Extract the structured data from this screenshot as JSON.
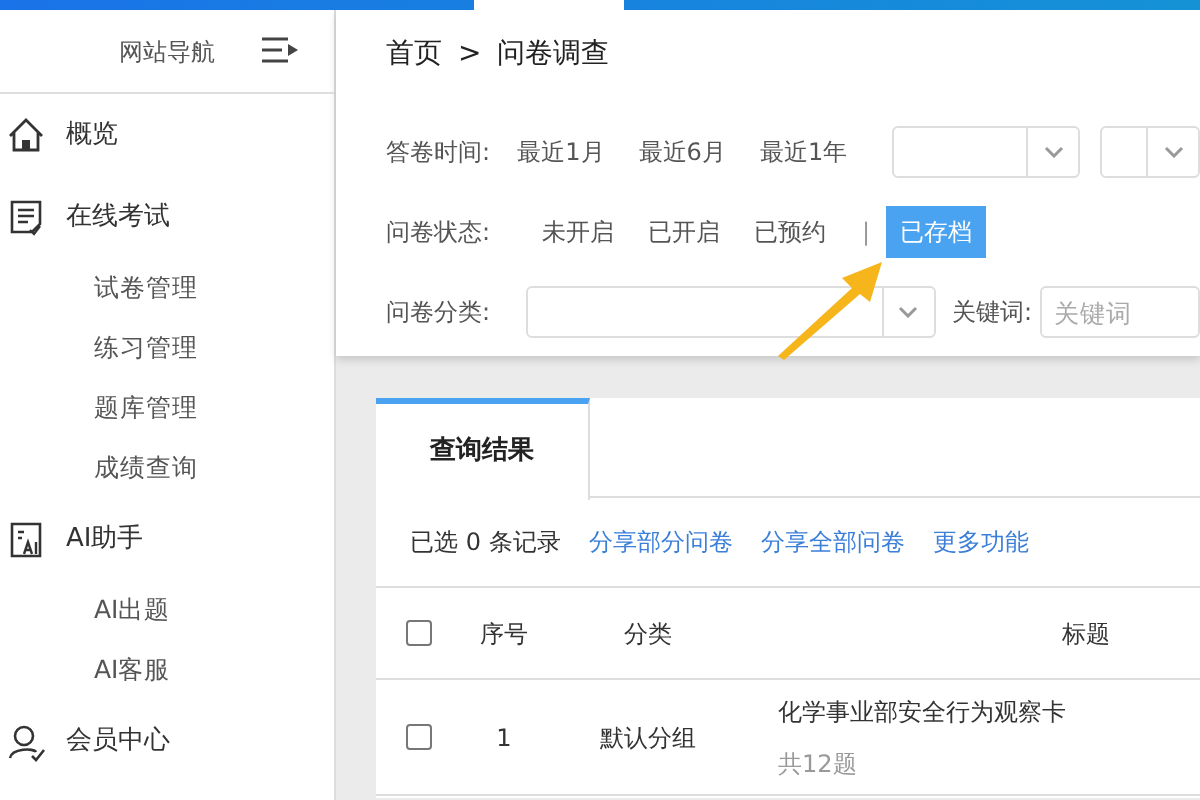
{
  "sidebar": {
    "title": "网站导航",
    "items": [
      {
        "label": "概览"
      },
      {
        "label": "在线考试",
        "children": [
          {
            "label": "试卷管理"
          },
          {
            "label": "练习管理"
          },
          {
            "label": "题库管理"
          },
          {
            "label": "成绩查询"
          }
        ]
      },
      {
        "label": "AI助手",
        "children": [
          {
            "label": "AI出题"
          },
          {
            "label": "AI客服"
          }
        ]
      },
      {
        "label": "会员中心"
      }
    ]
  },
  "breadcrumb": {
    "items": [
      "首页",
      "问卷调查"
    ],
    "separator": ">"
  },
  "filters": {
    "time": {
      "label": "答卷时间:",
      "options": [
        {
          "label": "最近1月",
          "selected": false
        },
        {
          "label": "最近6月",
          "selected": false
        },
        {
          "label": "最近1年",
          "selected": false
        }
      ]
    },
    "status": {
      "label": "问卷状态:",
      "separator": "|",
      "options": [
        {
          "label": "未开启",
          "selected": false
        },
        {
          "label": "已开启",
          "selected": false
        },
        {
          "label": "已预约",
          "selected": false
        },
        {
          "label": "已存档",
          "selected": true
        }
      ]
    },
    "category": {
      "label": "问卷分类:"
    },
    "keyword": {
      "label": "关键词:",
      "placeholder": "关键词"
    }
  },
  "results": {
    "tab": "查询结果",
    "selection": "已选 0 条记录",
    "actions": [
      "分享部分问卷",
      "分享全部问卷",
      "更多功能"
    ],
    "select_all_checked": false,
    "columns": [
      "序号",
      "分类",
      "标题"
    ],
    "rows": [
      {
        "checked": false,
        "index": "1",
        "category": "默认分组",
        "title": "化学事业部安全行为观察卡",
        "count": "共12题"
      }
    ]
  }
}
